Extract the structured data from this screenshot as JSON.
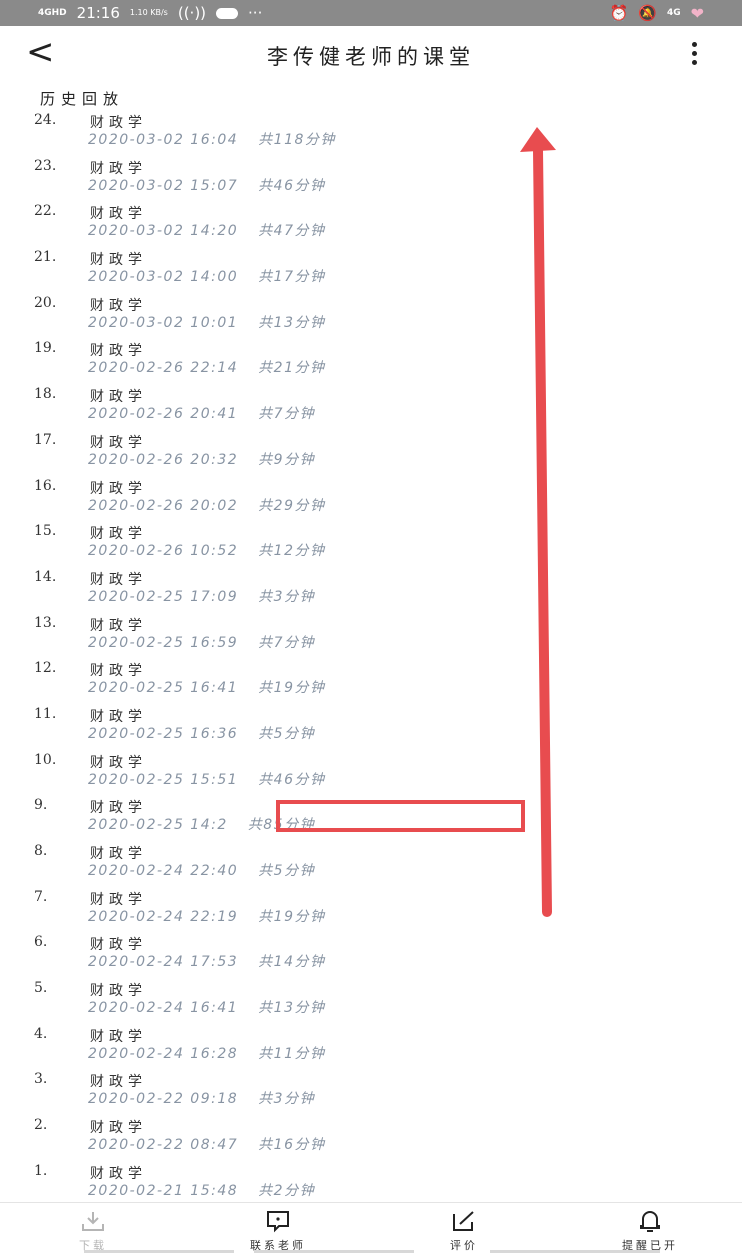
{
  "statusbar": {
    "signal": "4GHD",
    "time": "21:16",
    "speed": "1.10 KB/s",
    "battery_text": "4G"
  },
  "header": {
    "title": "李传健老师的课堂"
  },
  "section_title": "历史回放",
  "items": [
    {
      "num": "24.",
      "name": "财政学",
      "datetime": "2020-03-02  16:04",
      "duration": "共118分钟"
    },
    {
      "num": "23.",
      "name": "财政学",
      "datetime": "2020-03-02  15:07",
      "duration": "共46分钟"
    },
    {
      "num": "22.",
      "name": "财政学",
      "datetime": "2020-03-02  14:20",
      "duration": "共47分钟"
    },
    {
      "num": "21.",
      "name": "财政学",
      "datetime": "2020-03-02  14:00",
      "duration": "共17分钟"
    },
    {
      "num": "20.",
      "name": "财政学",
      "datetime": "2020-03-02  10:01",
      "duration": "共13分钟"
    },
    {
      "num": "19.",
      "name": "财政学",
      "datetime": "2020-02-26  22:14",
      "duration": "共21分钟"
    },
    {
      "num": "18.",
      "name": "财政学",
      "datetime": "2020-02-26  20:41",
      "duration": "共7分钟"
    },
    {
      "num": "17.",
      "name": "财政学",
      "datetime": "2020-02-26  20:32",
      "duration": "共9分钟"
    },
    {
      "num": "16.",
      "name": "财政学",
      "datetime": "2020-02-26  20:02",
      "duration": "共29分钟"
    },
    {
      "num": "15.",
      "name": "财政学",
      "datetime": "2020-02-26  10:52",
      "duration": "共12分钟"
    },
    {
      "num": "14.",
      "name": "财政学",
      "datetime": "2020-02-25  17:09",
      "duration": "共3分钟"
    },
    {
      "num": "13.",
      "name": "财政学",
      "datetime": "2020-02-25  16:59",
      "duration": "共7分钟"
    },
    {
      "num": "12.",
      "name": "财政学",
      "datetime": "2020-02-25  16:41",
      "duration": "共19分钟"
    },
    {
      "num": "11.",
      "name": "财政学",
      "datetime": "2020-02-25  16:36",
      "duration": "共5分钟"
    },
    {
      "num": "10.",
      "name": "财政学",
      "datetime": "2020-02-25  15:51",
      "duration": "共46分钟"
    },
    {
      "num": "9.",
      "name": "财政学",
      "datetime": "2020-02-25  14:2",
      "duration": "共85分钟"
    },
    {
      "num": "8.",
      "name": "财政学",
      "datetime": "2020-02-24  22:40",
      "duration": "共5分钟"
    },
    {
      "num": "7.",
      "name": "财政学",
      "datetime": "2020-02-24  22:19",
      "duration": "共19分钟"
    },
    {
      "num": "6.",
      "name": "财政学",
      "datetime": "2020-02-24  17:53",
      "duration": "共14分钟"
    },
    {
      "num": "5.",
      "name": "财政学",
      "datetime": "2020-02-24  16:41",
      "duration": "共13分钟"
    },
    {
      "num": "4.",
      "name": "财政学",
      "datetime": "2020-02-24  16:28",
      "duration": "共11分钟"
    },
    {
      "num": "3.",
      "name": "财政学",
      "datetime": "2020-02-22  09:18",
      "duration": "共3分钟"
    },
    {
      "num": "2.",
      "name": "财政学",
      "datetime": "2020-02-22  08:47",
      "duration": "共16分钟"
    },
    {
      "num": "1.",
      "name": "财政学",
      "datetime": "2020-02-21  15:48",
      "duration": "共2分钟"
    }
  ],
  "bottombar": {
    "download": "下载",
    "contact": "联系老师",
    "review": "评价",
    "remind": "提醒已开"
  },
  "colors": {
    "annotation_red": "#e84c4f",
    "meta_gray": "#8894a3"
  }
}
